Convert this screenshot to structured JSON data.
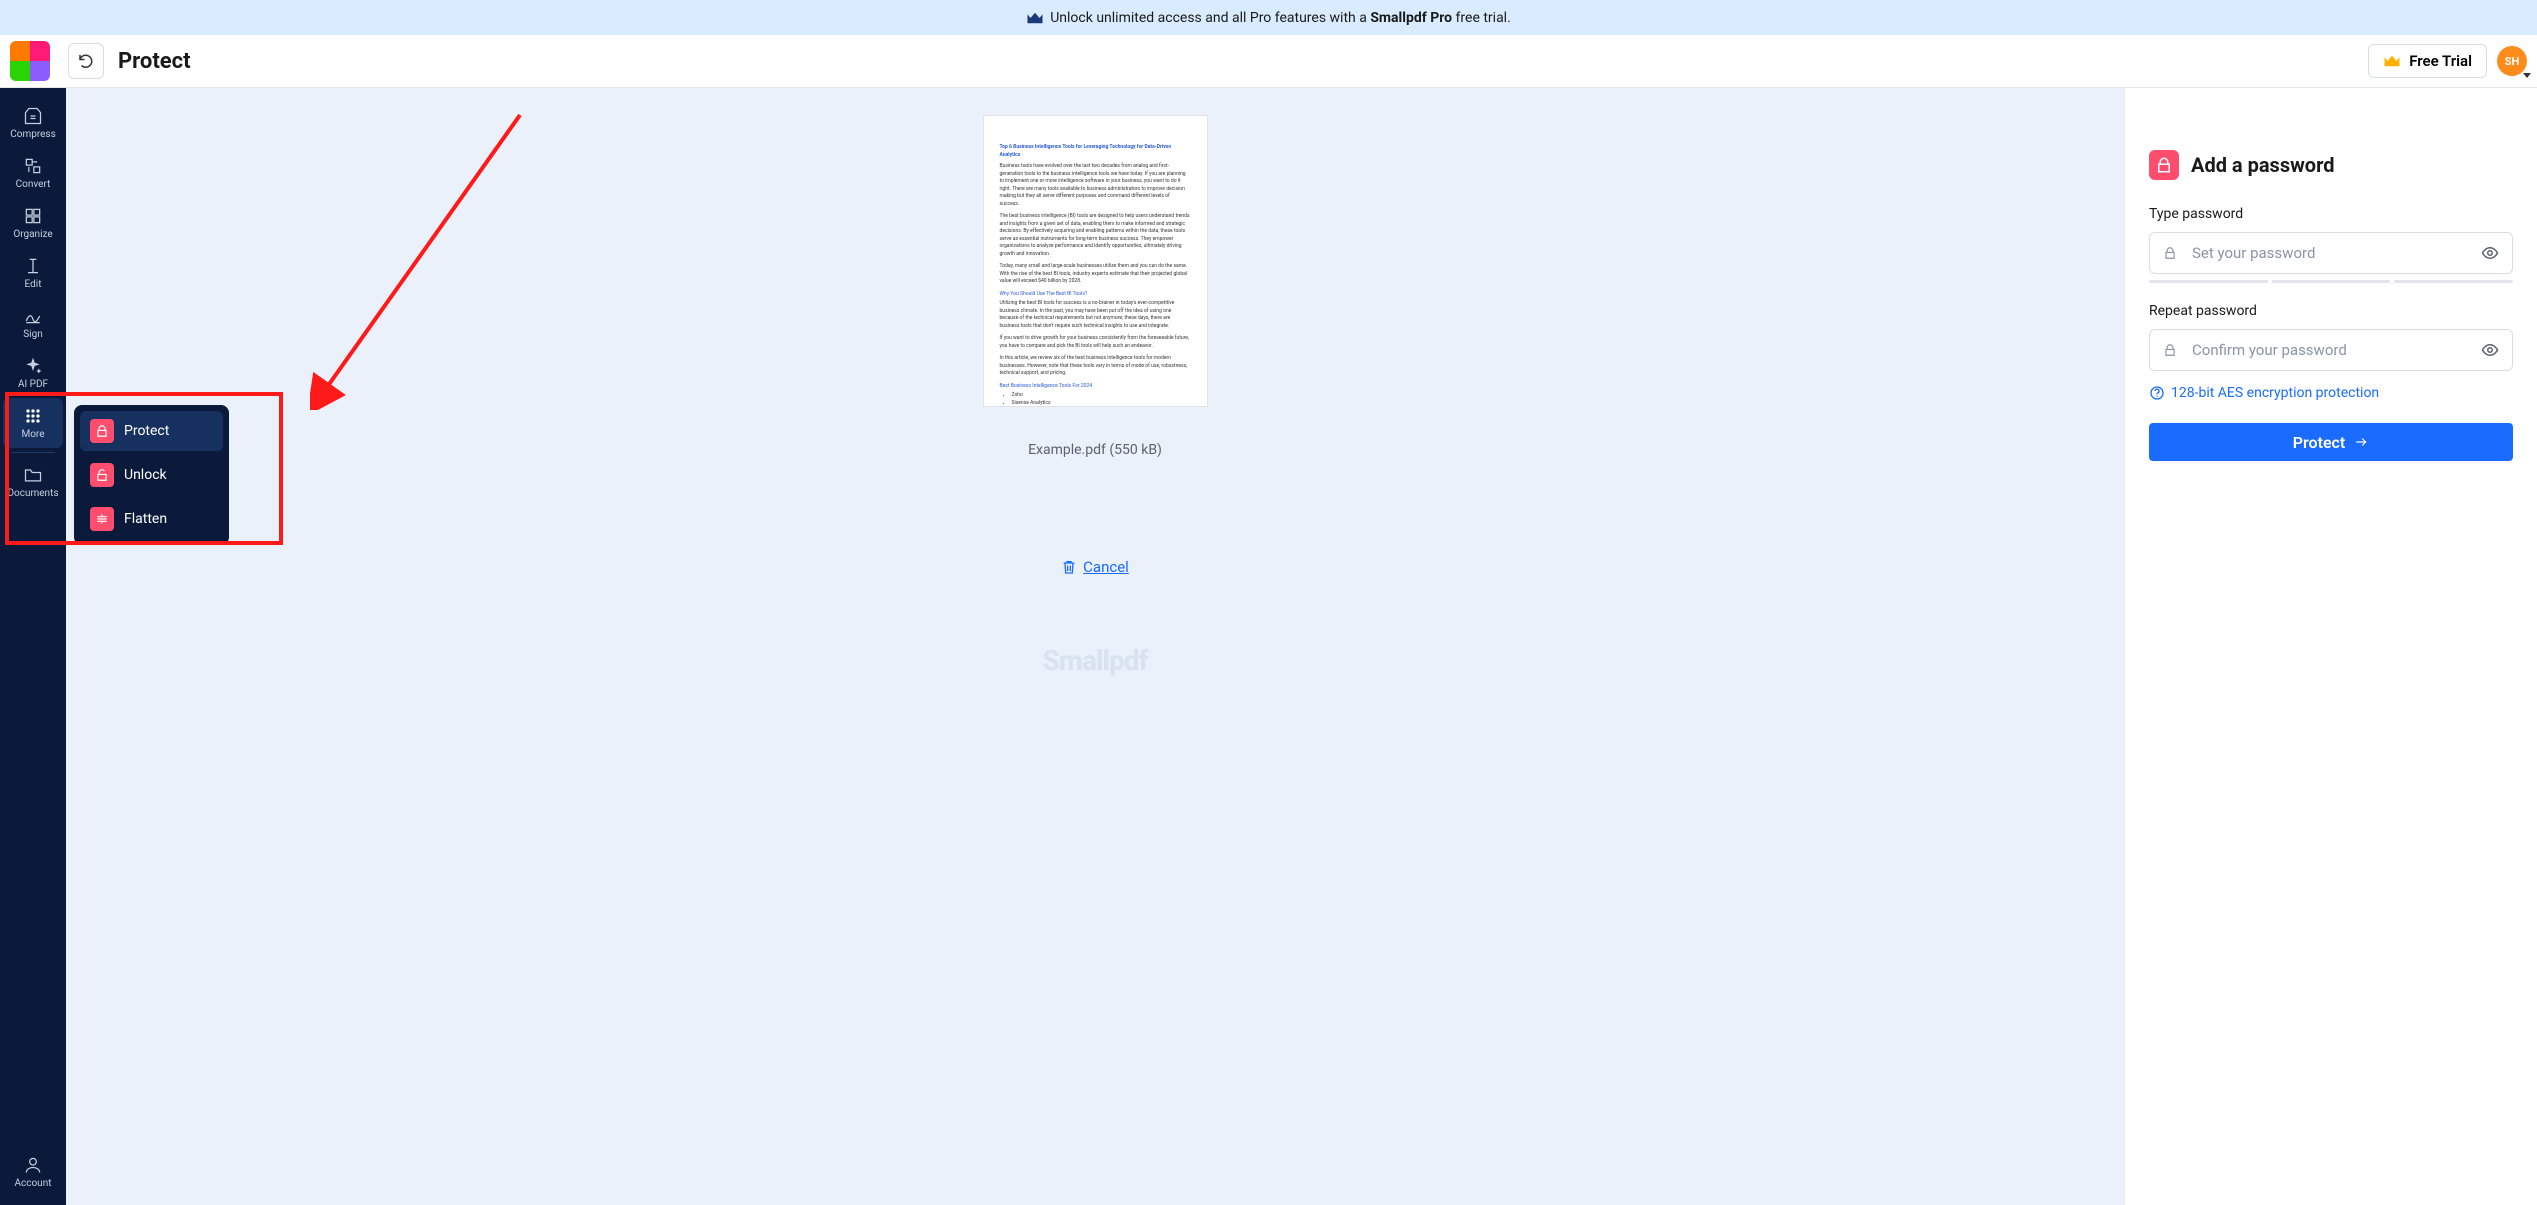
{
  "promo": {
    "prefix": "Unlock unlimited access and all Pro features with a ",
    "brand": "Smallpdf Pro",
    "suffix": " free trial."
  },
  "topbar": {
    "title": "Protect",
    "free_trial": "Free Trial",
    "avatar_initials": "SH"
  },
  "sidebar": {
    "items": [
      {
        "label": "Compress"
      },
      {
        "label": "Convert"
      },
      {
        "label": "Organize"
      },
      {
        "label": "Edit"
      },
      {
        "label": "Sign"
      },
      {
        "label": "AI PDF"
      },
      {
        "label": "More"
      },
      {
        "label": "Documents"
      }
    ],
    "account_label": "Account"
  },
  "more_menu": {
    "items": [
      {
        "label": "Protect"
      },
      {
        "label": "Unlock"
      },
      {
        "label": "Flatten"
      }
    ]
  },
  "document": {
    "filename": "Example.pdf",
    "filesize": "(550 kB)",
    "cancel": "Cancel",
    "watermark": "Smallpdf"
  },
  "panel": {
    "heading": "Add a password",
    "type_label": "Type password",
    "type_placeholder": "Set your password",
    "repeat_label": "Repeat password",
    "repeat_placeholder": "Confirm your password",
    "encryption_note": "128-bit AES encryption protection",
    "button": "Protect"
  },
  "colors": {
    "accent": "#1a6bff",
    "danger": "#ff4d6d",
    "sidebar_bg": "#0b1a3a"
  }
}
